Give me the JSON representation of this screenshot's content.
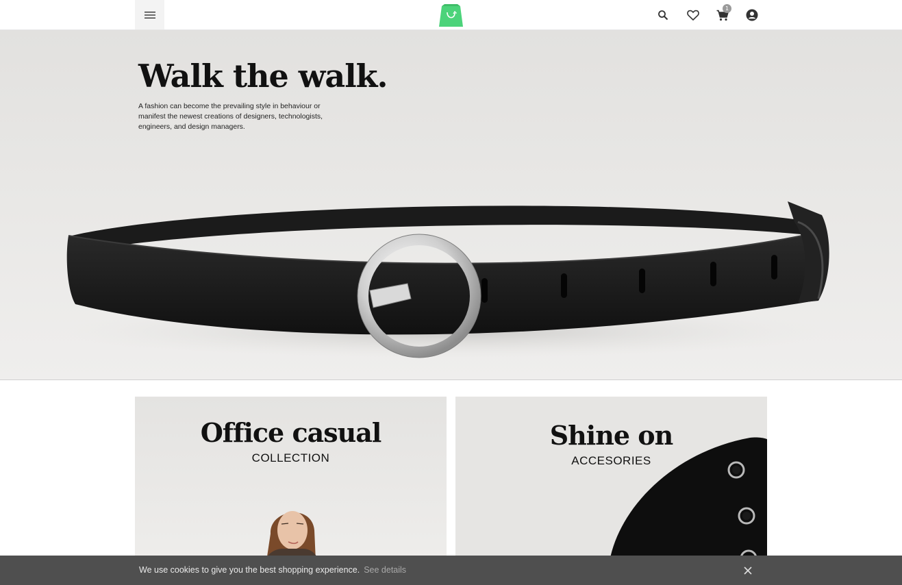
{
  "header": {
    "menu_icon": "hamburger-menu-icon",
    "logo_icon": "shopping-bag-logo-icon",
    "brand_color": "#4cd37a",
    "search_icon": "search-icon",
    "wishlist_icon": "heart-icon",
    "cart_icon": "cart-icon",
    "cart_count": "1",
    "account_icon": "account-circle-icon"
  },
  "hero": {
    "title": "Walk the walk.",
    "text": "A fashion can become the prevailing style in behaviour or manifest the newest creations of designers, technologists, engineers, and design managers."
  },
  "tiles": [
    {
      "title": "Office casual",
      "subtitle": "COLLECTION"
    },
    {
      "title": "Shine on",
      "subtitle": "ACCESORIES"
    }
  ],
  "cookie": {
    "text": "We use cookies to give you the best shopping experience.",
    "link": "See details",
    "close_icon": "close-icon"
  }
}
